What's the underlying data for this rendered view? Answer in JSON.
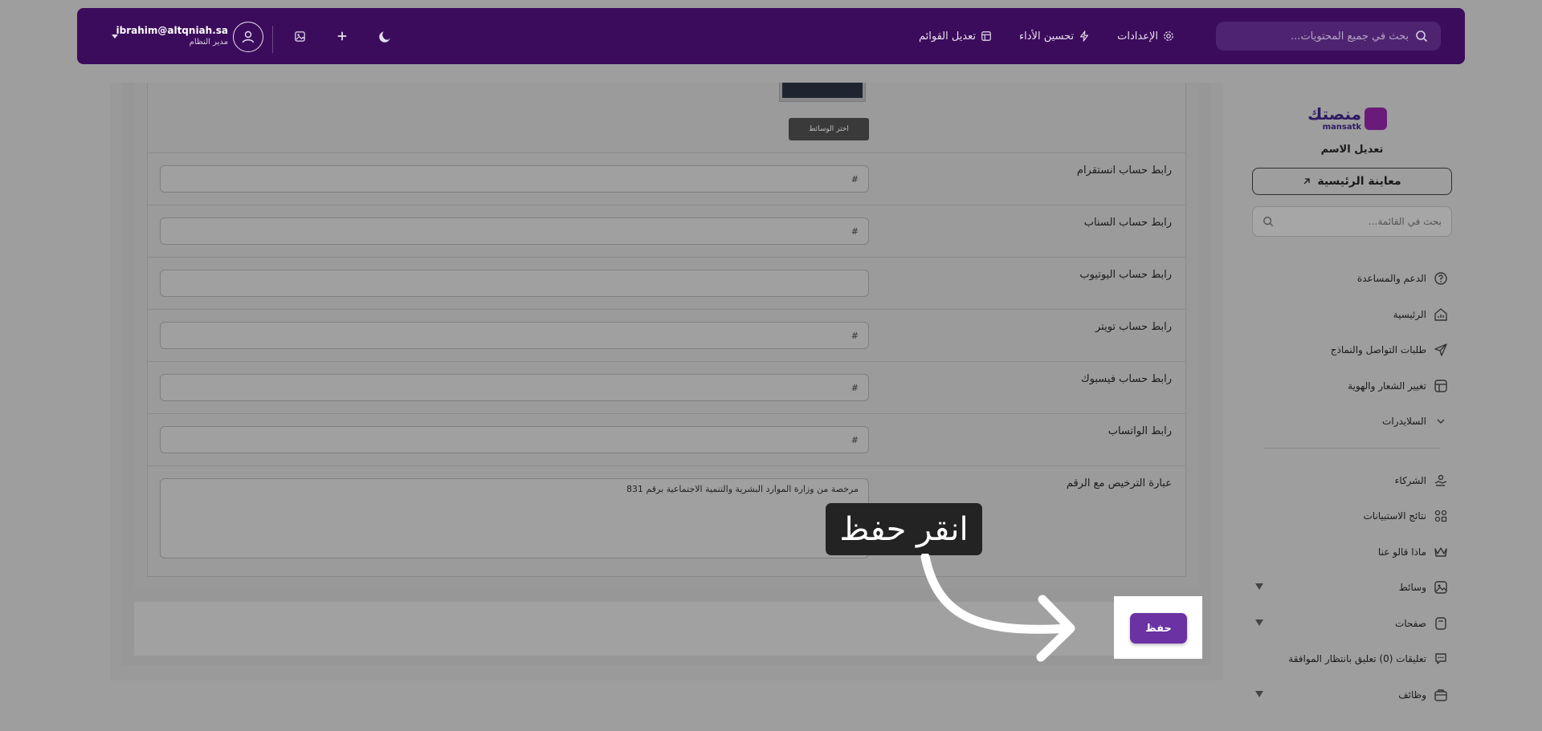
{
  "navbar": {
    "search_placeholder": "بحث في جميع المحتويات...",
    "menu": [
      {
        "label": "الإعدادات",
        "icon": "gear-icon"
      },
      {
        "label": "تحسين الأداء",
        "icon": "bolt-icon"
      },
      {
        "label": "تعديل القوائم",
        "icon": "layout-icon"
      }
    ],
    "user": {
      "email": "ibrahim@altqniah.sa",
      "role": "مدير النظام"
    }
  },
  "sidebar": {
    "logo_text": "منصتك",
    "logo_sub": "mansatk",
    "site_name": "تعديل الاسم",
    "preview_label": "معاينة الرئيسية",
    "search_placeholder": "بحث في القائمة...",
    "items": [
      {
        "label": "الدعم والمساعدة",
        "icon": "help-circle-icon"
      },
      {
        "label": "الرئيسية",
        "icon": "chart-home-icon"
      },
      {
        "label": "طلبات التواصل والنماذج",
        "icon": "send-icon"
      },
      {
        "label": "تغيير الشعار والهوية",
        "icon": "layout-icon"
      },
      {
        "label": "السلايدرات",
        "icon": "chevron-down-icon"
      }
    ],
    "items2": [
      {
        "label": "الشركاء",
        "icon": "handshake-icon"
      },
      {
        "label": "نتائج الاستبيانات",
        "icon": "grid-shapes-icon"
      },
      {
        "label": "ماذا قالو عنا",
        "icon": "crown-icon"
      },
      {
        "label": "وسائط",
        "icon": "image-icon"
      },
      {
        "label": "صفحات",
        "icon": "pages-icon"
      },
      {
        "label": "تعليقات (0) تعليق بانتظار الموافقة",
        "icon": "comment-icon"
      },
      {
        "label": "وظائف",
        "icon": "briefcase-icon"
      }
    ]
  },
  "form": {
    "choose_media_label": "اختر الوسائط",
    "fields": [
      {
        "label": "رابط حساب انستقرام",
        "value": "#"
      },
      {
        "label": "رابط حساب السناب",
        "value": "#"
      },
      {
        "label": "رابط حساب اليوتيوب",
        "value": ""
      },
      {
        "label": "رابط حساب تويتر",
        "value": "#"
      },
      {
        "label": "رابط حساب فيسبوك",
        "value": "#"
      },
      {
        "label": "رابط الواتساب",
        "value": "#"
      }
    ],
    "license": {
      "label": "عبارة الترخيص مع الرقم",
      "value": "مرخصة من وزارة الموارد البشرية والتنمية الاجتماعية برقم 831"
    },
    "save_label": "حفظ"
  },
  "hint": {
    "text": "انقر حفظ"
  }
}
